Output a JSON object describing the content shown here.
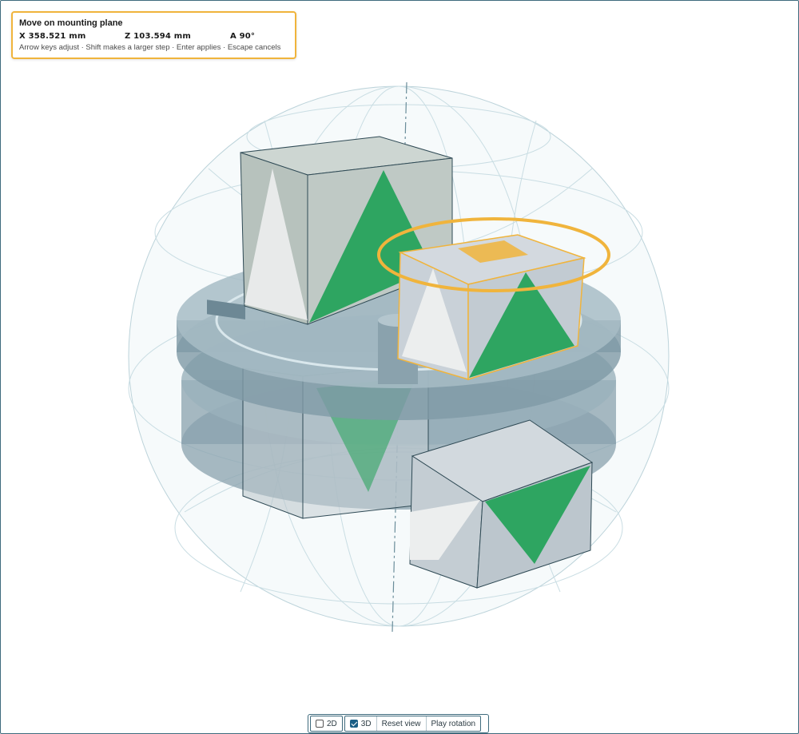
{
  "hud": {
    "title": "Move on mounting plane",
    "x_value": "X 358.521 mm",
    "z_value": "Z 103.594 mm",
    "a_value": "A 90°",
    "hint": "Arrow keys adjust · Shift makes a larger step · Enter applies · Escape cancels"
  },
  "toolbar": {
    "view_2d_label": "2D",
    "view_2d_checked": false,
    "view_3d_label": "3D",
    "view_3d_checked": true,
    "reset_label": "Reset view",
    "play_label": "Play rotation"
  },
  "colors": {
    "accent_selection": "#f0b43c",
    "face_green": "#2ea561",
    "plate": "#8aa2ad",
    "frame_border": "#3f6b7d"
  }
}
